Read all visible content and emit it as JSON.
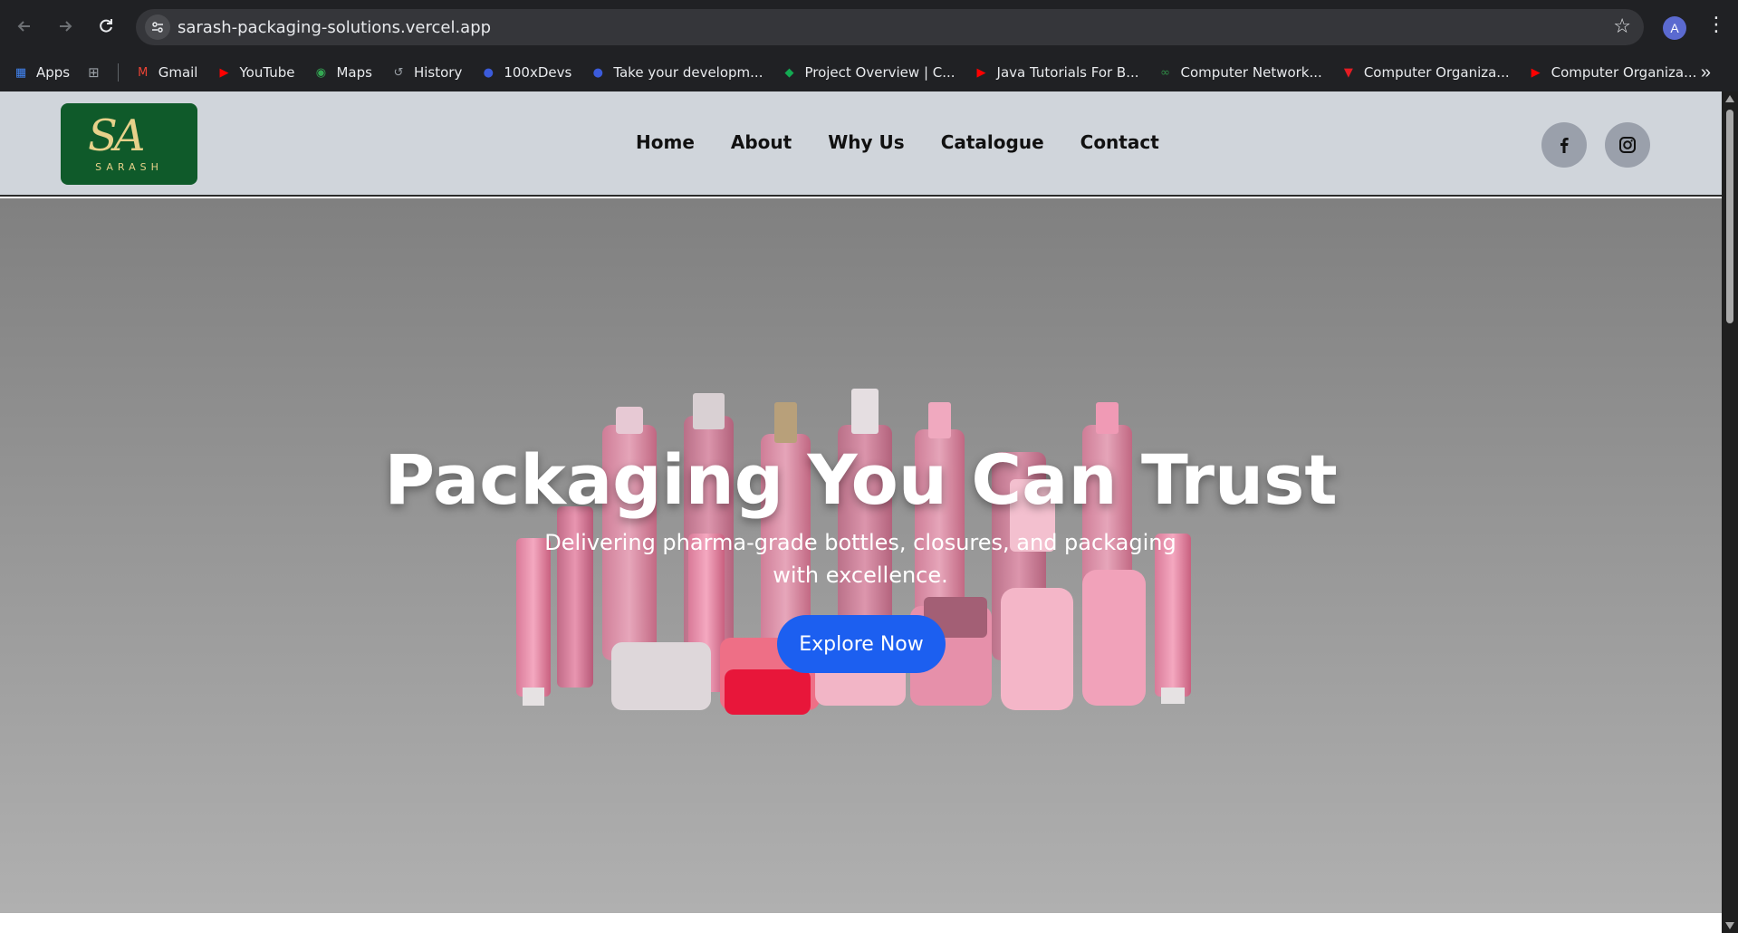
{
  "browser": {
    "url": "sarash-packaging-solutions.vercel.app",
    "profile_initial": "A",
    "bookmarks": [
      {
        "label": "Apps",
        "icon": "apps-grid-icon",
        "color": "#4285f4"
      },
      {
        "label": "Gmail",
        "icon": "gmail-icon",
        "color": "#ea4335"
      },
      {
        "label": "YouTube",
        "icon": "youtube-icon",
        "color": "#ff0000"
      },
      {
        "label": "Maps",
        "icon": "maps-icon",
        "color": "#34a853"
      },
      {
        "label": "History",
        "icon": "history-icon",
        "color": "#9aa0a6"
      },
      {
        "label": "100xDevs",
        "icon": "avatar-icon",
        "color": "#3b5bdb"
      },
      {
        "label": "Take your developm...",
        "icon": "avatar-icon",
        "color": "#3b5bdb"
      },
      {
        "label": "Project Overview | C...",
        "icon": "mongodb-icon",
        "color": "#13aa52"
      },
      {
        "label": "Java Tutorials For B...",
        "icon": "youtube-icon",
        "color": "#ff0000"
      },
      {
        "label": "Computer Network...",
        "icon": "gfg-icon",
        "color": "#2f8d46"
      },
      {
        "label": "Computer Organiza...",
        "icon": "triangle-icon",
        "color": "#e51c23"
      },
      {
        "label": "Computer Organiza...",
        "icon": "youtube-icon",
        "color": "#ff0000"
      }
    ]
  },
  "site": {
    "logo_mark": "SA",
    "logo_word": "SARASH",
    "nav": [
      "Home",
      "About",
      "Why Us",
      "Catalogue",
      "Contact"
    ],
    "hero": {
      "title": "Packaging You Can Trust",
      "subtitle": "Delivering pharma-grade bottles, closures, and packaging with excellence.",
      "cta": "Explore Now"
    }
  },
  "colors": {
    "header_bg": "#d0d5db",
    "cta_blue": "#1c5ff0",
    "logo_green": "#0f5a2a",
    "product_pink": "#f08fb0"
  }
}
